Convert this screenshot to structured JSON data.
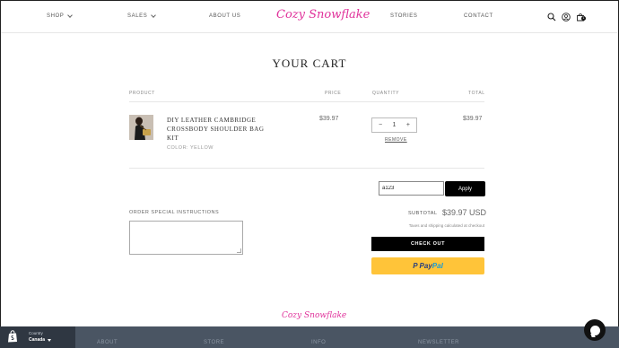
{
  "nav": {
    "items": [
      {
        "label": "SHOP",
        "dropdown": true
      },
      {
        "label": "SALES",
        "dropdown": true
      },
      {
        "label": "ABOUT US",
        "dropdown": false
      }
    ],
    "logo": "Cozy Snowflake",
    "right_items": [
      {
        "label": "STORIES"
      },
      {
        "label": "CONTACT"
      }
    ],
    "icons": [
      "search-icon",
      "account-icon",
      "cart-icon"
    ],
    "cart_count": "1"
  },
  "cart": {
    "title": "YOUR CART",
    "headers": {
      "product": "PRODUCT",
      "price": "PRICE",
      "quantity": "QUANTITY",
      "total": "TOTAL"
    },
    "items": [
      {
        "name": "DIY LEATHER CAMBRIDGE CROSSBODY SHOULDER BAG KIT",
        "variant": "COLOR: YELLOW",
        "price": "$39.97",
        "quantity": "1",
        "total": "$39.97",
        "remove_label": "REMOVE"
      }
    ],
    "discount": {
      "value": "a123",
      "apply_label": "Apply"
    },
    "notes_label": "ORDER SPECIAL INSTRUCTIONS",
    "subtotal_label": "SUBTOTAL",
    "subtotal_value": "$39.97 USD",
    "tax_note": "Taxes and shipping calculated at checkout",
    "checkout_label": "CHECK OUT",
    "paypal": {
      "p": "P",
      "pay": "Pay",
      "pal": "Pal"
    }
  },
  "footer": {
    "logo": "Cozy Snowflake",
    "columns": [
      "ABOUT",
      "STORE",
      "INFO",
      "NEWSLETTER"
    ]
  },
  "country_selector": {
    "label": "Country",
    "value": "Canada"
  },
  "colors": {
    "brand": "#e0329b",
    "paypal": "#ffc439",
    "bar": "#4a5563"
  }
}
